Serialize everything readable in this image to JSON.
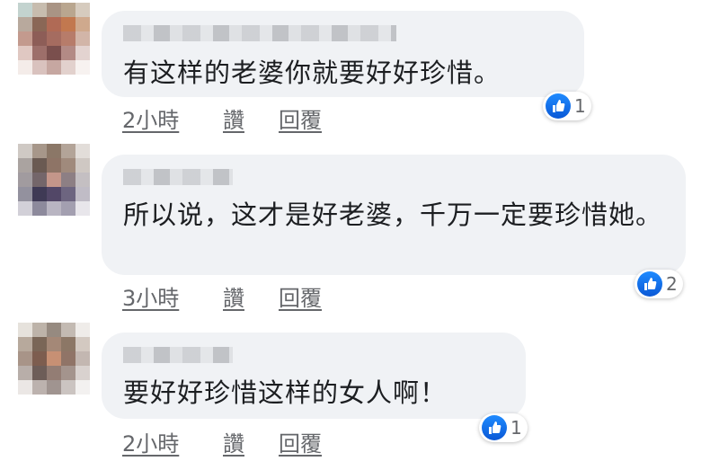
{
  "comments": [
    {
      "text": "有这样的老婆你就要好好珍惜。",
      "time": "2小時",
      "like_label": "讚",
      "reply_label": "回覆",
      "reaction_count": "1",
      "reaction_icon": "thumbs-up-icon"
    },
    {
      "text": "所以说，这才是好老婆，千万一定要珍惜她。",
      "time": "3小時",
      "like_label": "讚",
      "reply_label": "回覆",
      "reaction_count": "2",
      "reaction_icon": "thumbs-up-icon"
    },
    {
      "text": "要好好珍惜这样的女人啊！",
      "time": "2小時",
      "like_label": "讚",
      "reply_label": "回覆",
      "reaction_count": "1",
      "reaction_icon": "thumbs-up-icon"
    }
  ],
  "colors": {
    "bubble": "#f0f2f5",
    "action_text": "#65676b",
    "like_blue": "#1877f2"
  }
}
